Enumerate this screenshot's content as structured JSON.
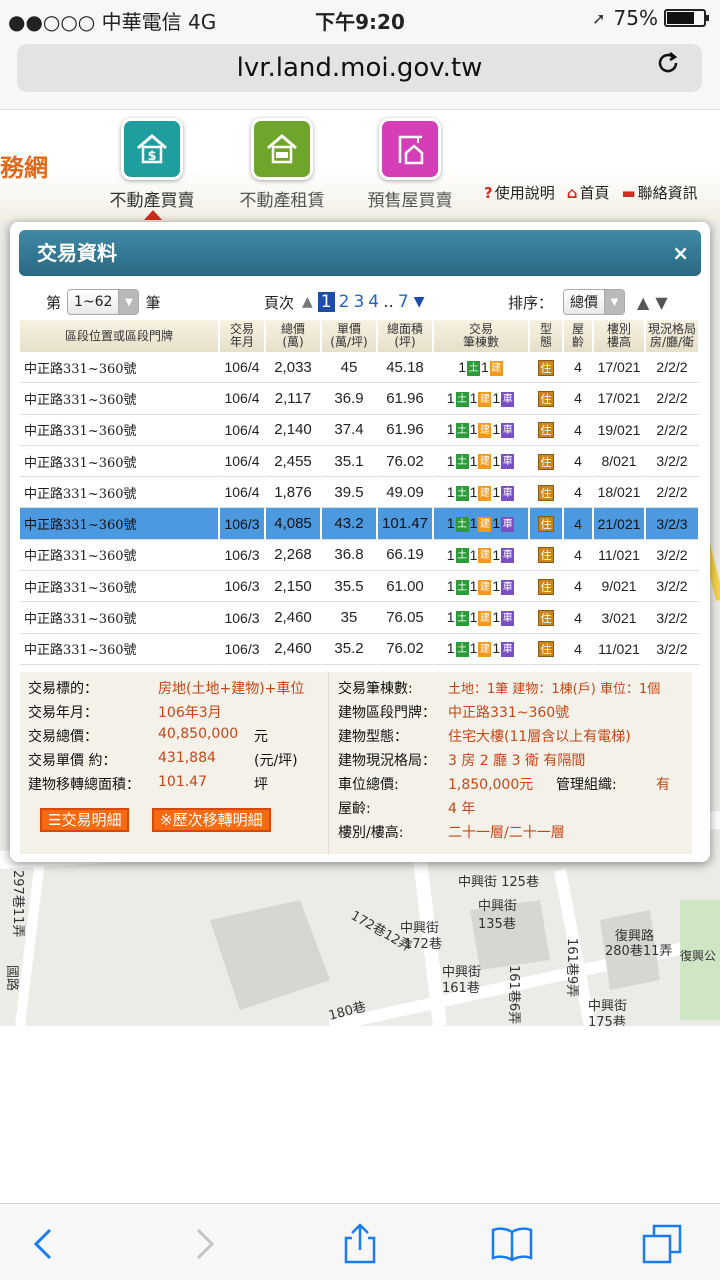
{
  "status": {
    "carrier": "●●○○○ 中華電信   4G",
    "time": "下午9:20",
    "battery": "75%",
    "battery_level": 0.75
  },
  "browser": {
    "url": "lvr.land.moi.gov.tw"
  },
  "site": {
    "logo_text": "務網",
    "tabs": [
      {
        "label": "不動產買賣",
        "color": "#1f9ea0"
      },
      {
        "label": "不動產租賃",
        "color": "#6fa52a"
      },
      {
        "label": "預售屋買賣",
        "color": "#d43fb7"
      }
    ],
    "links": [
      "使用說明",
      "首頁",
      "聯絡資訊"
    ]
  },
  "dialog": {
    "title": "交易資料",
    "close": "×",
    "page_prefix": "第",
    "page_range": "1~62",
    "page_suffix": "筆",
    "pager_label": "頁次",
    "pages": [
      "1",
      "2",
      "3",
      "4",
      "..",
      "7"
    ],
    "sort_label": "排序：",
    "sort_value": "總價",
    "columns": [
      "區段位置或區段門牌",
      "交易\n年月",
      "總價\n(萬)",
      "單價\n(萬/坪)",
      "總面積\n(坪)",
      "交易\n筆棟數",
      "型\n態",
      "屋\n齡",
      "樓別\n樓高",
      "現況格局\n房/廳/衛"
    ],
    "rows": [
      {
        "addr": "中正路331~360號",
        "ym": "106/4",
        "total": "2,033",
        "unit": "45",
        "area": "45.18",
        "n1": "1",
        "n2": "1",
        "n3": "",
        "type": "住",
        "age": "4",
        "floor": "17/021",
        "layout": "2/2/2"
      },
      {
        "addr": "中正路331~360號",
        "ym": "106/4",
        "total": "2,117",
        "unit": "36.9",
        "area": "61.96",
        "n1": "1",
        "n2": "1",
        "n3": "1",
        "type": "住",
        "age": "4",
        "floor": "17/021",
        "layout": "2/2/2"
      },
      {
        "addr": "中正路331~360號",
        "ym": "106/4",
        "total": "2,140",
        "unit": "37.4",
        "area": "61.96",
        "n1": "1",
        "n2": "1",
        "n3": "1",
        "type": "住",
        "age": "4",
        "floor": "19/021",
        "layout": "2/2/2"
      },
      {
        "addr": "中正路331~360號",
        "ym": "106/4",
        "total": "2,455",
        "unit": "35.1",
        "area": "76.02",
        "n1": "1",
        "n2": "1",
        "n3": "1",
        "type": "住",
        "age": "4",
        "floor": "8/021",
        "layout": "3/2/2"
      },
      {
        "addr": "中正路331~360號",
        "ym": "106/4",
        "total": "1,876",
        "unit": "39.5",
        "area": "49.09",
        "n1": "1",
        "n2": "1",
        "n3": "1",
        "type": "住",
        "age": "4",
        "floor": "18/021",
        "layout": "2/2/2"
      },
      {
        "addr": "中正路331~360號",
        "ym": "106/3",
        "total": "4,085",
        "unit": "43.2",
        "area": "101.47",
        "n1": "1",
        "n2": "1",
        "n3": "1",
        "type": "住",
        "age": "4",
        "floor": "21/021",
        "layout": "3/2/3"
      },
      {
        "addr": "中正路331~360號",
        "ym": "106/3",
        "total": "2,268",
        "unit": "36.8",
        "area": "66.19",
        "n1": "1",
        "n2": "1",
        "n3": "1",
        "type": "住",
        "age": "4",
        "floor": "11/021",
        "layout": "3/2/2"
      },
      {
        "addr": "中正路331~360號",
        "ym": "106/3",
        "total": "2,150",
        "unit": "35.5",
        "area": "61.00",
        "n1": "1",
        "n2": "1",
        "n3": "1",
        "type": "住",
        "age": "4",
        "floor": "9/021",
        "layout": "3/2/2"
      },
      {
        "addr": "中正路331~360號",
        "ym": "106/3",
        "total": "2,460",
        "unit": "35",
        "area": "76.05",
        "n1": "1",
        "n2": "1",
        "n3": "1",
        "type": "住",
        "age": "4",
        "floor": "3/021",
        "layout": "3/2/2"
      },
      {
        "addr": "中正路331~360號",
        "ym": "106/3",
        "total": "2,460",
        "unit": "35.2",
        "area": "76.02",
        "n1": "1",
        "n2": "1",
        "n3": "1",
        "type": "住",
        "age": "4",
        "floor": "11/021",
        "layout": "3/2/2"
      }
    ],
    "selected_row": 5,
    "badges": {
      "land": "土",
      "building": "建",
      "car": "車"
    },
    "detail": {
      "target_label": "交易標的：",
      "target": "房地(土地+建物)+車位",
      "ym_label": "交易年月：",
      "ym": "106年3月",
      "total_label": "交易總價：",
      "total": "40,850,000",
      "total_unit": "元",
      "unit_label": "交易單價 約：",
      "unit": "431,884",
      "unit_unit": "(元/坪)",
      "area_label": "建物移轉總面積：",
      "area": "101.47",
      "area_unit": "坪",
      "count_label": "交易筆棟數:",
      "count": "土地：1筆 建物：1棟(戶) 車位：1個",
      "door_label": "建物區段門牌：",
      "door": "中正路331~360號",
      "btype_label": "建物型態：",
      "btype": "住宅大樓(11層含以上有電梯)",
      "blayout_label": "建物現況格局：",
      "blayout": "3 房 2 廳 3 衛 有隔間",
      "car_label": "車位總價:",
      "car": "1,850,000元",
      "mgmt_label": "管理組織:",
      "mgmt": "有",
      "age_label": "屋齡:",
      "age": "4  年",
      "floor_label": "樓別/樓高:",
      "floor": "二十一層/二十一層",
      "btn_detail": "交易明細",
      "btn_history": "※歷次移轉明細"
    }
  },
  "map_labels": {
    "l1": "中興街 125巷",
    "l2": "中興街",
    "l3": "135巷",
    "l4": "中興街",
    "l5": "172巷",
    "l6": "172巷12弄",
    "l7": "中興",
    "l8": "161巷9弄",
    "l9": "復興路",
    "l10": "280巷11弄",
    "l11": "復興公",
    "l12": "中興街",
    "l13": "161巷",
    "l14": "161巷6弄",
    "l15": "中興街",
    "l16": "175巷",
    "l17": "180巷",
    "l18": "297巷11弄",
    "l19": "國路",
    "l20": "中興街",
    "l21": "中興"
  }
}
